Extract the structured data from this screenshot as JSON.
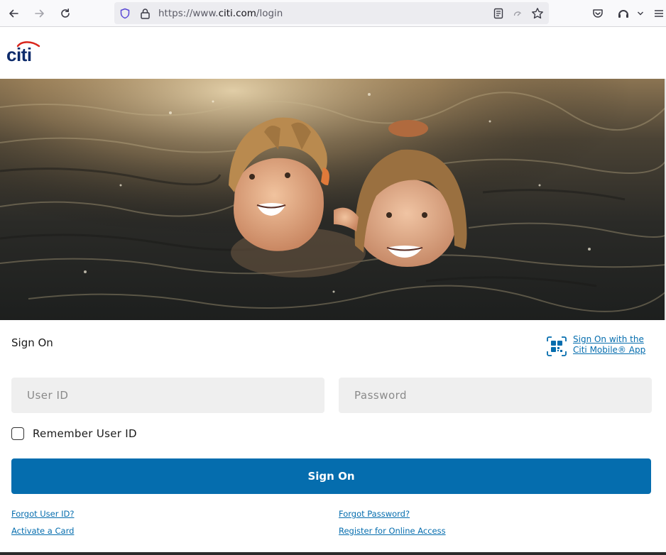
{
  "browser": {
    "url_prefix": "https://www.",
    "url_host": "citi.com",
    "url_path": "/login"
  },
  "header": {
    "logo_text": "citi"
  },
  "hero": {
    "image": "children-swimming-photo"
  },
  "signon": {
    "title": "Sign On",
    "mobile_link_line1": "Sign On with the ",
    "mobile_link_line2": "Citi Mobile® App",
    "user_placeholder": "User ID",
    "password_placeholder": "Password",
    "remember_label": "Remember User ID",
    "button_label": "Sign On"
  },
  "links": {
    "forgot_user": "Forgot User ID?",
    "forgot_password": "Forgot Password?",
    "activate_card": "Activate a Card",
    "register": "Register for Online Access"
  },
  "colors": {
    "brand_blue": "#056dae",
    "logo_red": "#d9261c",
    "field_bg": "#efefef"
  }
}
